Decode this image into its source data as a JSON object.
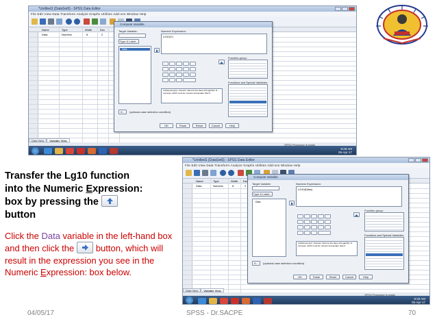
{
  "screenshot_top": {
    "window_title": "*Untitled1 [DataSet0] - SPSS Data Editor",
    "menu": "File  Edit  View  Data  Transform  Analyze  Graphs  Utilities  Add-ons  Window  Help",
    "columns": [
      "Name",
      "Type",
      "Width",
      "Dec"
    ],
    "row1": [
      "Data",
      "Numeric",
      "8",
      "2"
    ],
    "dialog": {
      "title": "Compute Variable",
      "target_label": "Target Variable:",
      "expr_label": "Numeric Expression:",
      "expr_value": "LG10(?)",
      "type_label": "Type & Label...",
      "var_item": "Data",
      "func_group_label": "Function group:",
      "func_groups": [
        "All",
        "Arithmetic",
        "CDF & Noncentral CDF",
        "Conversion",
        "Current Date/Time",
        "Date Arithmetic"
      ],
      "func_label": "Functions and Special Variables:",
      "funcs": [
        "Abs",
        "Arsin",
        "Artan",
        "Cos",
        "Exp",
        "Lg10",
        "Ln",
        "Lngamma",
        "Mod",
        "Rnd",
        "Sin",
        "Sqrt"
      ],
      "desc": "LG10(numexpr). Numeric. Returns the base-10 logarithm of numexpr, which must be numeric and greater than 0.",
      "if_label": "If...",
      "if_text": "(optional case selection condition)",
      "buttons": [
        "OK",
        "Paste",
        "Reset",
        "Cancel",
        "Help"
      ]
    },
    "tabs": [
      "Data View",
      "Variable View"
    ],
    "status": "SPSS Processor is ready",
    "clock_time": "8:29 AM",
    "clock_date": "05-Apr-17"
  },
  "screenshot_bottom": {
    "window_title": "*Untitled1 [DataSet0] - SPSS Data Editor",
    "menu": "File  Edit  View  Data  Transform  Analyze  Graphs  Utilities  Add-ons  Window  Help",
    "columns": [
      "Name",
      "Type",
      "Width",
      "Dec"
    ],
    "row1": [
      "Data",
      "Numeric",
      "8",
      "2"
    ],
    "dialog": {
      "title": "Compute Variable",
      "target_label": "Target Variable:",
      "expr_label": "Numeric Expression:",
      "expr_value": "LG10(Data)",
      "type_label": "Type & Label...",
      "var_item": "Data",
      "func_group_label": "Function group:",
      "func_label": "Functions and Special Variables:",
      "desc": "LG10(numexpr). Numeric. Returns the base-10 logarithm of numexpr, which must be numeric and greater than 0.",
      "if_label": "If...",
      "if_text": "(optional case selection condition)",
      "buttons": [
        "OK",
        "Paste",
        "Reset",
        "Cancel",
        "Help"
      ]
    },
    "tabs": [
      "Data View",
      "Variable View"
    ],
    "status": "SPSS Processor is ready",
    "clock_time": "8:29 AM",
    "clock_date": "05-Apr-17"
  },
  "instructions": {
    "line1": "Transfer the Lg10 function",
    "line2": "into the Numeric ",
    "line2_u": "E",
    "line2_rest": "xpression:",
    "line3": "box by pressing the",
    "line4": "button",
    "p2_a": "Click the ",
    "p2_data": "Data",
    "p2_b": " variable in the left-hand box and then click the",
    "p2_c": "button, which will result in the expression you see in the Numeric ",
    "p2_u": "E",
    "p2_d": "xpression: box below."
  },
  "footer": {
    "date": "04/05/17",
    "center": "SPSS - Dr.SACPE",
    "page": "70"
  },
  "colors": {
    "instruction_red": "#cc0000",
    "data_purple": "#7b3fa0",
    "footer_gray": "#7f7f7f"
  }
}
